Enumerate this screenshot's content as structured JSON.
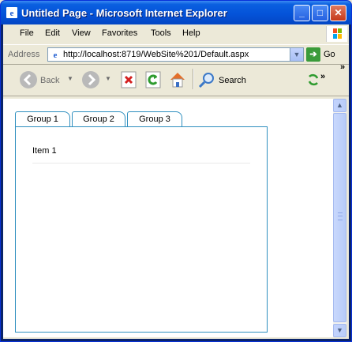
{
  "window": {
    "title": "Untitled Page - Microsoft Internet Explorer"
  },
  "menu": {
    "items": [
      "File",
      "Edit",
      "View",
      "Favorites",
      "Tools",
      "Help"
    ]
  },
  "address": {
    "label": "Address",
    "url": "http://localhost:8719/WebSite%201/Default.aspx",
    "go_label": "Go"
  },
  "toolbar": {
    "back_label": "Back",
    "search_label": "Search",
    "overflow": "»"
  },
  "page": {
    "tabs": [
      {
        "label": "Group 1",
        "active": true
      },
      {
        "label": "Group 2",
        "active": false
      },
      {
        "label": "Group 3",
        "active": false
      }
    ],
    "panel_item": "Item 1"
  },
  "colors": {
    "titlebar": "#0453D9",
    "tab_border": "#2F8FBF"
  },
  "icons": [
    "ie-icon",
    "minimize-icon",
    "maximize-icon",
    "close-icon",
    "windows-logo-icon",
    "back-icon",
    "forward-icon",
    "stop-icon",
    "refresh-icon",
    "home-icon",
    "search-icon",
    "go-icon",
    "scroll-up-icon",
    "scroll-down-icon"
  ]
}
